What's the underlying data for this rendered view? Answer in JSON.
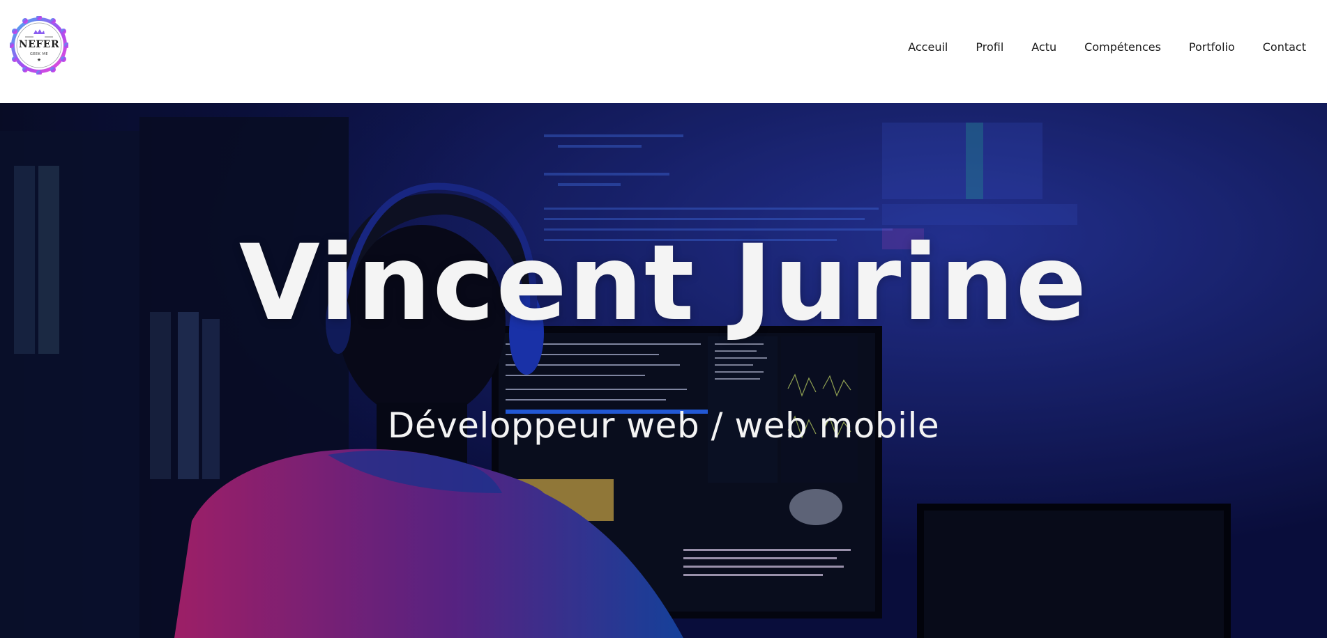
{
  "brand": {
    "logo_text": "NEFER",
    "logo_tagline": "GEEK ME",
    "accent_gradient": [
      "#3fb6f0",
      "#a64bf0",
      "#f04bd6"
    ]
  },
  "nav": {
    "items": [
      {
        "label": "Acceuil"
      },
      {
        "label": "Profil"
      },
      {
        "label": "Actu"
      },
      {
        "label": "Compétences"
      },
      {
        "label": "Portfolio"
      },
      {
        "label": "Contact"
      }
    ]
  },
  "hero": {
    "title": "Vincent Jurine",
    "subtitle": "Développeur web / web mobile",
    "background_colors": {
      "deep_navy": "#0b0f3a",
      "royal_blue": "#1f2c8f",
      "magenta": "#c0267a",
      "cyan": "#2aa0ff"
    }
  }
}
